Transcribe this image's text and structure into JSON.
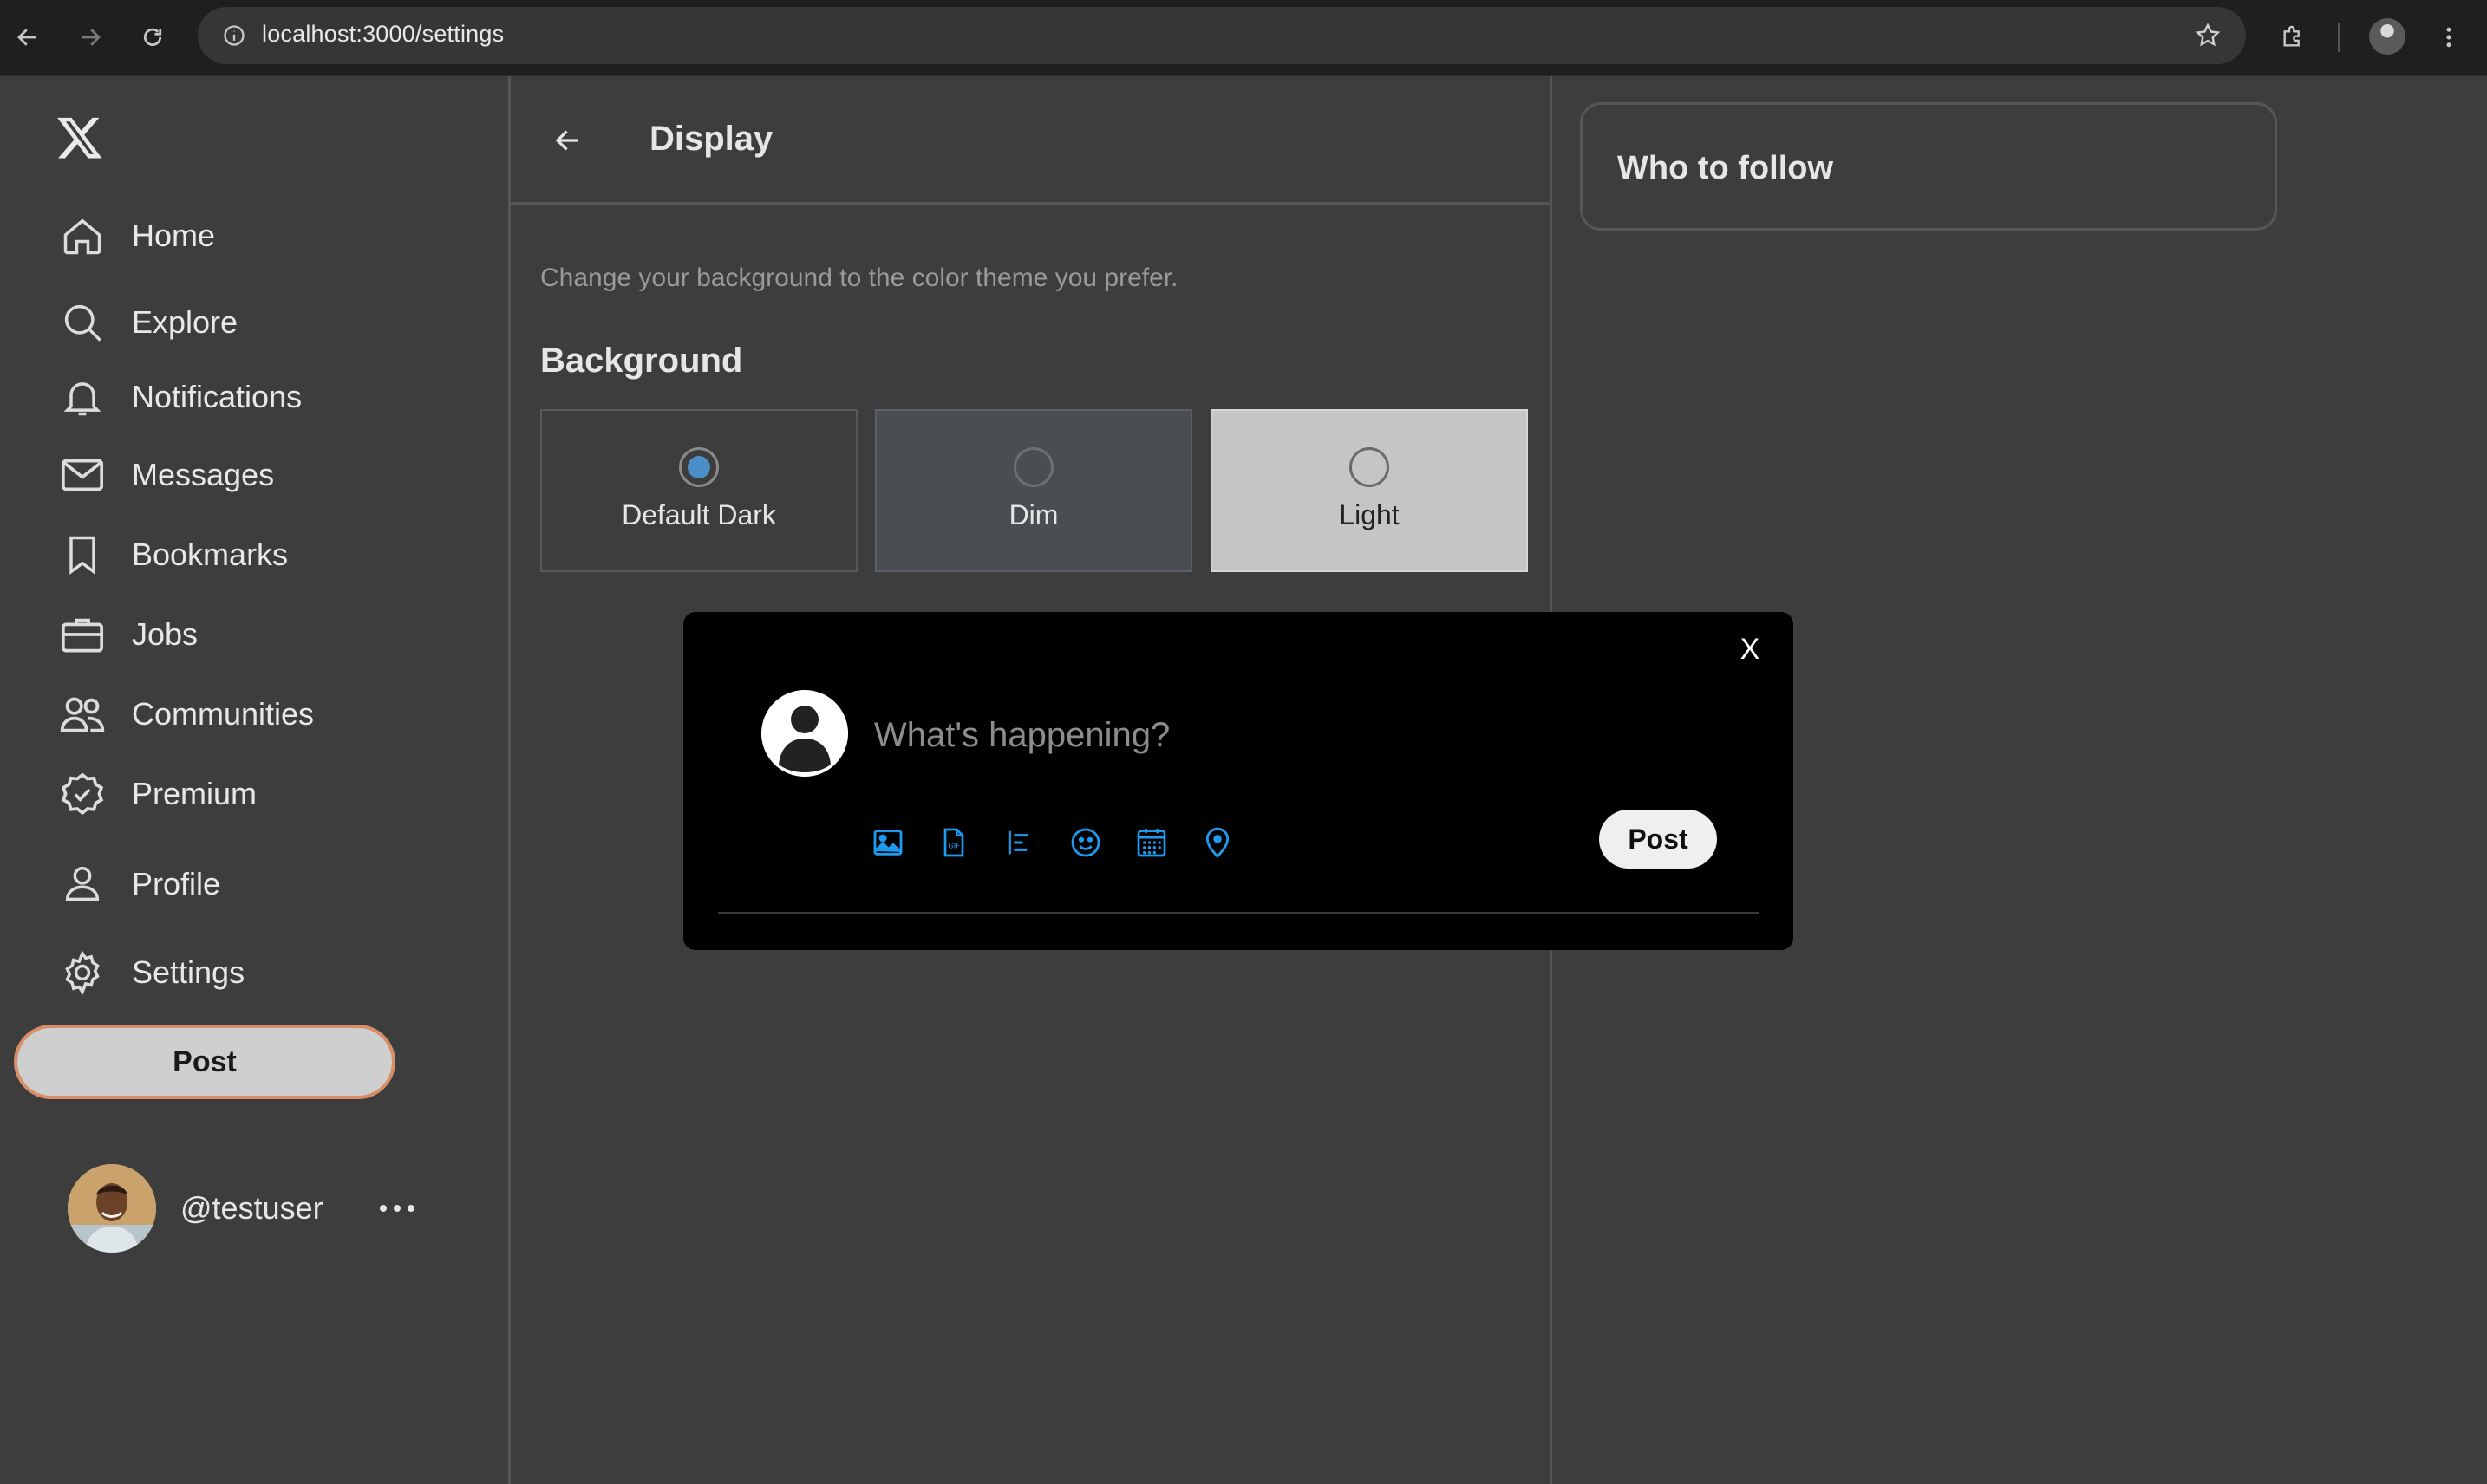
{
  "browser": {
    "url": "localhost:3000/settings",
    "icons": [
      "back-icon",
      "forward-icon",
      "reload-icon",
      "site-info-icon",
      "bookmark-star-icon",
      "extensions-icon",
      "profile-avatar",
      "browser-menu-icon"
    ]
  },
  "sidebar": {
    "logo": "X",
    "items": [
      {
        "label": "Home",
        "icon": "home-icon"
      },
      {
        "label": "Explore",
        "icon": "search-icon"
      },
      {
        "label": "Notifications",
        "icon": "bell-icon"
      },
      {
        "label": "Messages",
        "icon": "envelope-icon"
      },
      {
        "label": "Bookmarks",
        "icon": "bookmark-icon"
      },
      {
        "label": "Jobs",
        "icon": "briefcase-icon"
      },
      {
        "label": "Communities",
        "icon": "people-icon"
      },
      {
        "label": "Premium",
        "icon": "verified-badge-icon"
      },
      {
        "label": "Profile",
        "icon": "person-icon"
      },
      {
        "label": "Settings",
        "icon": "gear-icon"
      }
    ],
    "post_label": "Post",
    "user_handle": "@testuser",
    "more_icon": "more-horizontal-icon"
  },
  "display": {
    "title": "Display",
    "description": "Change your background to the color theme you prefer.",
    "background_heading": "Background",
    "options": [
      {
        "label": "Default Dark",
        "selected": true
      },
      {
        "label": "Dim",
        "selected": false
      },
      {
        "label": "Light",
        "selected": false
      }
    ]
  },
  "right": {
    "who_to_follow": "Who to follow"
  },
  "composer": {
    "close_label": "X",
    "placeholder": "What's happening?",
    "post_label": "Post",
    "tools": [
      "image-icon",
      "gif-icon",
      "poll-icon",
      "emoji-icon",
      "schedule-icon",
      "location-icon"
    ],
    "accent_color": "#1d9bf0"
  }
}
